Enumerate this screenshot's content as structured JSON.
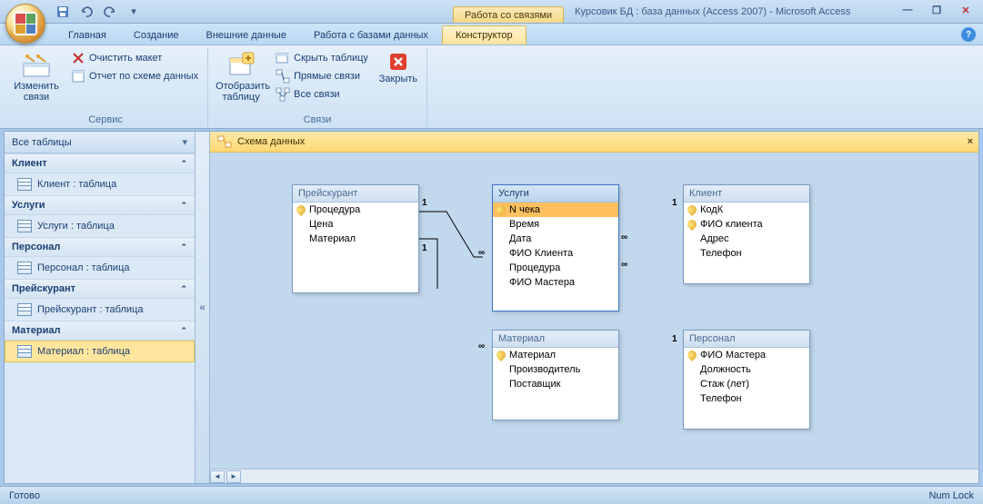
{
  "title": {
    "context_tab": "Работа со связями",
    "app_title": "Курсовик БД : база данных (Access 2007) - Microsoft Access"
  },
  "tabs": {
    "home": "Главная",
    "create": "Создание",
    "external": "Внешние данные",
    "dbtools": "Работа с базами данных",
    "designer": "Конструктор"
  },
  "ribbon": {
    "grp_service": "Сервис",
    "grp_links": "Связи",
    "edit_links": "Изменить связи",
    "clear_layout": "Очистить макет",
    "schema_report": "Отчет по схеме данных",
    "show_table": "Отобразить таблицу",
    "hide_table": "Скрыть таблицу",
    "direct_links": "Прямые связи",
    "all_links": "Все связи",
    "close": "Закрыть"
  },
  "nav": {
    "header": "Все таблицы",
    "groups": [
      {
        "name": "Клиент",
        "item": "Клиент : таблица"
      },
      {
        "name": "Услуги",
        "item": "Услуги : таблица"
      },
      {
        "name": "Персонал",
        "item": "Персонал : таблица"
      },
      {
        "name": "Прейскурант",
        "item": "Прейскурант : таблица"
      },
      {
        "name": "Материал",
        "item": "Материал : таблица"
      }
    ]
  },
  "doc": {
    "tab_title": "Схема данных"
  },
  "entities": {
    "e0": {
      "title": "Прейскурант",
      "fields": [
        {
          "n": "Процедура",
          "k": true
        },
        {
          "n": "Цена"
        },
        {
          "n": "Материал"
        }
      ]
    },
    "e1": {
      "title": "Услуги",
      "fields": [
        {
          "n": "N чека",
          "k": true,
          "sel": true
        },
        {
          "n": "Время"
        },
        {
          "n": "Дата"
        },
        {
          "n": "ФИО Клиента"
        },
        {
          "n": "Процедура"
        },
        {
          "n": "ФИО Мастера"
        }
      ]
    },
    "e2": {
      "title": "Клиент",
      "fields": [
        {
          "n": "КодК",
          "k": true
        },
        {
          "n": "ФИО клиента",
          "k": true
        },
        {
          "n": "Адрес"
        },
        {
          "n": "Телефон"
        }
      ]
    },
    "e3": {
      "title": "Материал",
      "fields": [
        {
          "n": "Материал",
          "k": true
        },
        {
          "n": "Производитель"
        },
        {
          "n": "Поставщик"
        }
      ]
    },
    "e4": {
      "title": "Персонал",
      "fields": [
        {
          "n": "ФИО Мастера",
          "k": true
        },
        {
          "n": "Должность"
        },
        {
          "n": "Стаж (лет)"
        },
        {
          "n": "Телефон"
        }
      ]
    }
  },
  "status": {
    "ready": "Готово",
    "numlock": "Num Lock"
  }
}
